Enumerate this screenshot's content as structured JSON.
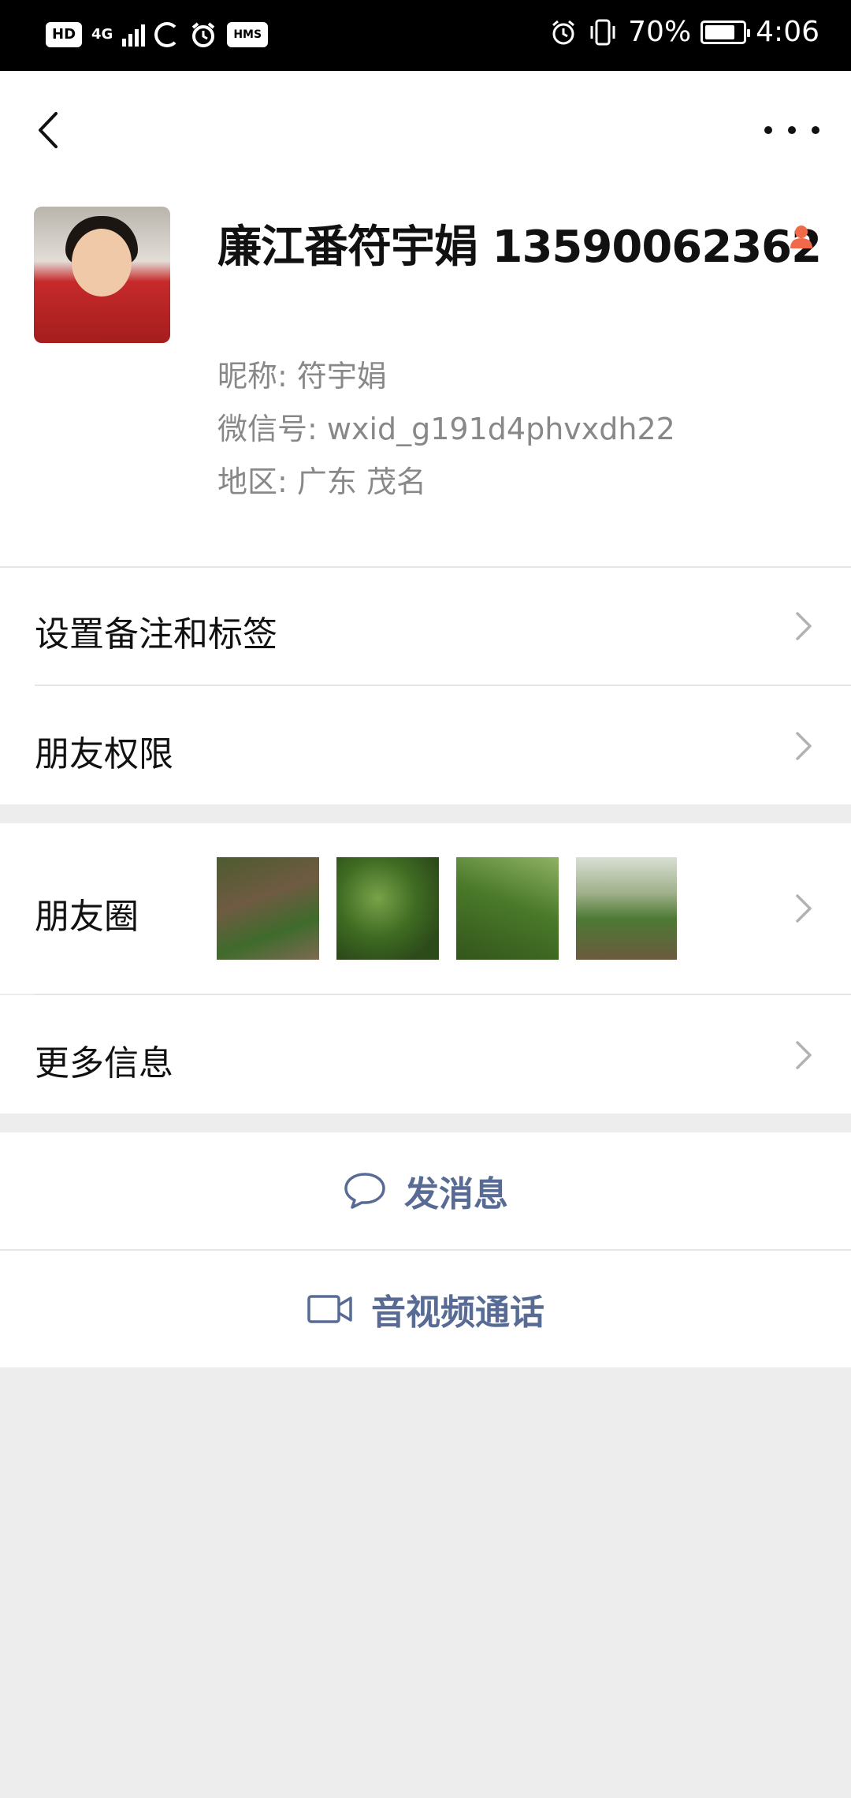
{
  "status_bar": {
    "hd": "HD",
    "network": "4G",
    "hms": "HMS",
    "battery_percent": "70%",
    "time": "4:06",
    "battery_level": 0.7
  },
  "profile": {
    "display_name": "廉江番符宇娟 13590062362",
    "nickname": "昵称:  符宇娟",
    "wechat_id": "微信号:  wxid_g191d4phvxdh22",
    "region": "地区:  广东  茂名",
    "gender_icon_color": "#f06a4a"
  },
  "cells": {
    "remark": "设置备注和标签",
    "permission": "朋友权限",
    "moments": "朋友圈",
    "more_info": "更多信息"
  },
  "actions": {
    "send_message": "发消息",
    "video_call": "音视频通话"
  },
  "colors": {
    "link_blue": "#576b95",
    "page_bg": "#ededed"
  }
}
